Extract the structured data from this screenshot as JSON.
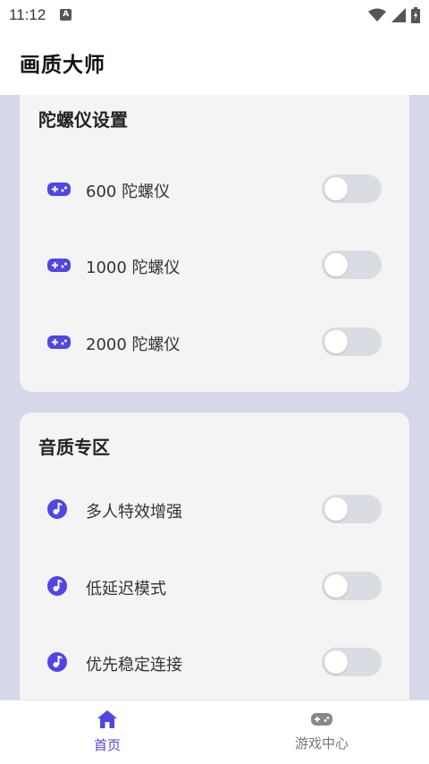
{
  "status_bar": {
    "time": "11:12",
    "notification_icon": "a-icon",
    "icons": [
      "wifi-icon",
      "signal-icon",
      "battery-icon"
    ]
  },
  "app_bar": {
    "title": "画质大师"
  },
  "colors": {
    "accent": "#4f46e5",
    "page_bg": "#d6d8e9",
    "card_bg": "#f4f4f4",
    "switch_off": "#d9dce3"
  },
  "gyro_section": {
    "title": "陀螺仪设置",
    "items": [
      {
        "label": "600 陀螺仪",
        "icon": "gamepad-icon",
        "enabled": false
      },
      {
        "label": "1000 陀螺仪",
        "icon": "gamepad-icon",
        "enabled": false
      },
      {
        "label": "2000 陀螺仪",
        "icon": "gamepad-icon",
        "enabled": false
      }
    ]
  },
  "audio_section": {
    "title": "音质专区",
    "items": [
      {
        "label": "多人特效增强",
        "icon": "music-note-icon",
        "enabled": false
      },
      {
        "label": "低延迟模式",
        "icon": "music-note-icon",
        "enabled": false
      },
      {
        "label": "优先稳定连接",
        "icon": "music-note-icon",
        "enabled": false
      }
    ]
  },
  "bottom_nav": {
    "items": [
      {
        "label": "首页",
        "icon": "home-icon",
        "active": true
      },
      {
        "label": "游戏中心",
        "icon": "gamepad-icon",
        "active": false
      }
    ]
  }
}
